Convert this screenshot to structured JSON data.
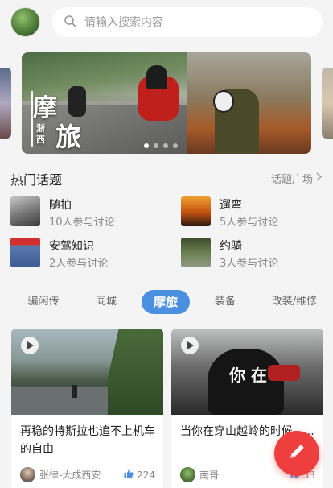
{
  "search": {
    "placeholder": "请输入搜索内容"
  },
  "banner": {
    "title_char1": "摩",
    "title_char2": "旅",
    "subtitle": "浙西"
  },
  "hot_topics": {
    "title": "热门话题",
    "more_label": "话题广场",
    "items": [
      {
        "name": "随拍",
        "meta": "10人参与讨论",
        "icon": "motorcycle-photo-thumb"
      },
      {
        "name": "遛弯",
        "meta": "5人参与讨论",
        "icon": "sunset-ride-thumb"
      },
      {
        "name": "安驾知识",
        "meta": "2人参与讨论",
        "icon": "safety-group-thumb"
      },
      {
        "name": "约骑",
        "meta": "3人参与讨论",
        "icon": "group-ride-thumb"
      }
    ]
  },
  "tabs": [
    {
      "label": "骗闲传",
      "active": false
    },
    {
      "label": "同城",
      "active": false
    },
    {
      "label": "摩旅",
      "active": true
    },
    {
      "label": "装备",
      "active": false
    },
    {
      "label": "改装/维修",
      "active": false
    }
  ],
  "cards": [
    {
      "title": "再稳的特斯拉也追不上机车的自由",
      "author": "张律-大成西安",
      "likes": "224"
    },
    {
      "title": "当你在穿山越岭的时候......",
      "author": "南哥",
      "likes": "53",
      "image_text": "你 在"
    }
  ],
  "colors": {
    "accent": "#4a8fe0",
    "fab": "#ee3e3e"
  }
}
